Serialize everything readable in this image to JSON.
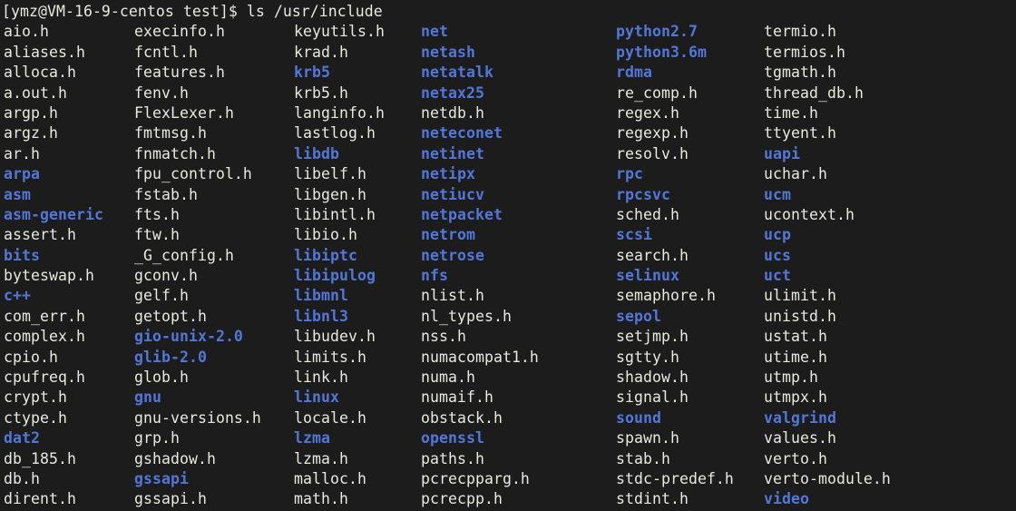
{
  "terminal": {
    "background_color": "#1c1c1c",
    "foreground_color": "#e9e9dd",
    "directory_color": "#5277d9",
    "prompt": "[ymz@VM-16-9-centos test]$ ",
    "command": "ls /usr/include"
  },
  "listing": {
    "columns": [
      {
        "entries": [
          {
            "name": "aio.h",
            "type": "file"
          },
          {
            "name": "aliases.h",
            "type": "file"
          },
          {
            "name": "alloca.h",
            "type": "file"
          },
          {
            "name": "a.out.h",
            "type": "file"
          },
          {
            "name": "argp.h",
            "type": "file"
          },
          {
            "name": "argz.h",
            "type": "file"
          },
          {
            "name": "ar.h",
            "type": "file"
          },
          {
            "name": "arpa",
            "type": "dir"
          },
          {
            "name": "asm",
            "type": "dir"
          },
          {
            "name": "asm-generic",
            "type": "dir"
          },
          {
            "name": "assert.h",
            "type": "file"
          },
          {
            "name": "bits",
            "type": "dir"
          },
          {
            "name": "byteswap.h",
            "type": "file"
          },
          {
            "name": "c++",
            "type": "dir"
          },
          {
            "name": "com_err.h",
            "type": "file"
          },
          {
            "name": "complex.h",
            "type": "file"
          },
          {
            "name": "cpio.h",
            "type": "file"
          },
          {
            "name": "cpufreq.h",
            "type": "file"
          },
          {
            "name": "crypt.h",
            "type": "file"
          },
          {
            "name": "ctype.h",
            "type": "file"
          },
          {
            "name": "dat2",
            "type": "dir"
          },
          {
            "name": "db_185.h",
            "type": "file"
          },
          {
            "name": "db.h",
            "type": "file"
          },
          {
            "name": "dirent.h",
            "type": "file"
          }
        ]
      },
      {
        "entries": [
          {
            "name": "execinfo.h",
            "type": "file"
          },
          {
            "name": "fcntl.h",
            "type": "file"
          },
          {
            "name": "features.h",
            "type": "file"
          },
          {
            "name": "fenv.h",
            "type": "file"
          },
          {
            "name": "FlexLexer.h",
            "type": "file"
          },
          {
            "name": "fmtmsg.h",
            "type": "file"
          },
          {
            "name": "fnmatch.h",
            "type": "file"
          },
          {
            "name": "fpu_control.h",
            "type": "file"
          },
          {
            "name": "fstab.h",
            "type": "file"
          },
          {
            "name": "fts.h",
            "type": "file"
          },
          {
            "name": "ftw.h",
            "type": "file"
          },
          {
            "name": "_G_config.h",
            "type": "file"
          },
          {
            "name": "gconv.h",
            "type": "file"
          },
          {
            "name": "gelf.h",
            "type": "file"
          },
          {
            "name": "getopt.h",
            "type": "file"
          },
          {
            "name": "gio-unix-2.0",
            "type": "dir"
          },
          {
            "name": "glib-2.0",
            "type": "dir"
          },
          {
            "name": "glob.h",
            "type": "file"
          },
          {
            "name": "gnu",
            "type": "dir"
          },
          {
            "name": "gnu-versions.h",
            "type": "file"
          },
          {
            "name": "grp.h",
            "type": "file"
          },
          {
            "name": "gshadow.h",
            "type": "file"
          },
          {
            "name": "gssapi",
            "type": "dir"
          },
          {
            "name": "gssapi.h",
            "type": "file"
          }
        ]
      },
      {
        "entries": [
          {
            "name": "keyutils.h",
            "type": "file"
          },
          {
            "name": "krad.h",
            "type": "file"
          },
          {
            "name": "krb5",
            "type": "dir"
          },
          {
            "name": "krb5.h",
            "type": "file"
          },
          {
            "name": "langinfo.h",
            "type": "file"
          },
          {
            "name": "lastlog.h",
            "type": "file"
          },
          {
            "name": "libdb",
            "type": "dir"
          },
          {
            "name": "libelf.h",
            "type": "file"
          },
          {
            "name": "libgen.h",
            "type": "file"
          },
          {
            "name": "libintl.h",
            "type": "file"
          },
          {
            "name": "libio.h",
            "type": "file"
          },
          {
            "name": "libiptc",
            "type": "dir"
          },
          {
            "name": "libipulog",
            "type": "dir"
          },
          {
            "name": "libmnl",
            "type": "dir"
          },
          {
            "name": "libnl3",
            "type": "dir"
          },
          {
            "name": "libudev.h",
            "type": "file"
          },
          {
            "name": "limits.h",
            "type": "file"
          },
          {
            "name": "link.h",
            "type": "file"
          },
          {
            "name": "linux",
            "type": "dir"
          },
          {
            "name": "locale.h",
            "type": "file"
          },
          {
            "name": "lzma",
            "type": "dir"
          },
          {
            "name": "lzma.h",
            "type": "file"
          },
          {
            "name": "malloc.h",
            "type": "file"
          },
          {
            "name": "math.h",
            "type": "file"
          }
        ]
      },
      {
        "entries": [
          {
            "name": "net",
            "type": "dir"
          },
          {
            "name": "netash",
            "type": "dir"
          },
          {
            "name": "netatalk",
            "type": "dir"
          },
          {
            "name": "netax25",
            "type": "dir"
          },
          {
            "name": "netdb.h",
            "type": "file"
          },
          {
            "name": "neteconet",
            "type": "dir"
          },
          {
            "name": "netinet",
            "type": "dir"
          },
          {
            "name": "netipx",
            "type": "dir"
          },
          {
            "name": "netiucv",
            "type": "dir"
          },
          {
            "name": "netpacket",
            "type": "dir"
          },
          {
            "name": "netrom",
            "type": "dir"
          },
          {
            "name": "netrose",
            "type": "dir"
          },
          {
            "name": "nfs",
            "type": "dir"
          },
          {
            "name": "nlist.h",
            "type": "file"
          },
          {
            "name": "nl_types.h",
            "type": "file"
          },
          {
            "name": "nss.h",
            "type": "file"
          },
          {
            "name": "numacompat1.h",
            "type": "file"
          },
          {
            "name": "numa.h",
            "type": "file"
          },
          {
            "name": "numaif.h",
            "type": "file"
          },
          {
            "name": "obstack.h",
            "type": "file"
          },
          {
            "name": "openssl",
            "type": "dir"
          },
          {
            "name": "paths.h",
            "type": "file"
          },
          {
            "name": "pcrecpparg.h",
            "type": "file"
          },
          {
            "name": "pcrecpp.h",
            "type": "file"
          }
        ]
      },
      {
        "entries": [
          {
            "name": "python2.7",
            "type": "dir"
          },
          {
            "name": "python3.6m",
            "type": "dir"
          },
          {
            "name": "rdma",
            "type": "dir"
          },
          {
            "name": "re_comp.h",
            "type": "file"
          },
          {
            "name": "regex.h",
            "type": "file"
          },
          {
            "name": "regexp.h",
            "type": "file"
          },
          {
            "name": "resolv.h",
            "type": "file"
          },
          {
            "name": "rpc",
            "type": "dir"
          },
          {
            "name": "rpcsvc",
            "type": "dir"
          },
          {
            "name": "sched.h",
            "type": "file"
          },
          {
            "name": "scsi",
            "type": "dir"
          },
          {
            "name": "search.h",
            "type": "file"
          },
          {
            "name": "selinux",
            "type": "dir"
          },
          {
            "name": "semaphore.h",
            "type": "file"
          },
          {
            "name": "sepol",
            "type": "dir"
          },
          {
            "name": "setjmp.h",
            "type": "file"
          },
          {
            "name": "sgtty.h",
            "type": "file"
          },
          {
            "name": "shadow.h",
            "type": "file"
          },
          {
            "name": "signal.h",
            "type": "file"
          },
          {
            "name": "sound",
            "type": "dir"
          },
          {
            "name": "spawn.h",
            "type": "file"
          },
          {
            "name": "stab.h",
            "type": "file"
          },
          {
            "name": "stdc-predef.h",
            "type": "file"
          },
          {
            "name": "stdint.h",
            "type": "file"
          }
        ]
      },
      {
        "entries": [
          {
            "name": "termio.h",
            "type": "file"
          },
          {
            "name": "termios.h",
            "type": "file"
          },
          {
            "name": "tgmath.h",
            "type": "file"
          },
          {
            "name": "thread_db.h",
            "type": "file"
          },
          {
            "name": "time.h",
            "type": "file"
          },
          {
            "name": "ttyent.h",
            "type": "file"
          },
          {
            "name": "uapi",
            "type": "dir"
          },
          {
            "name": "uchar.h",
            "type": "file"
          },
          {
            "name": "ucm",
            "type": "dir"
          },
          {
            "name": "ucontext.h",
            "type": "file"
          },
          {
            "name": "ucp",
            "type": "dir"
          },
          {
            "name": "ucs",
            "type": "dir"
          },
          {
            "name": "uct",
            "type": "dir"
          },
          {
            "name": "ulimit.h",
            "type": "file"
          },
          {
            "name": "unistd.h",
            "type": "file"
          },
          {
            "name": "ustat.h",
            "type": "file"
          },
          {
            "name": "utime.h",
            "type": "file"
          },
          {
            "name": "utmp.h",
            "type": "file"
          },
          {
            "name": "utmpx.h",
            "type": "file"
          },
          {
            "name": "valgrind",
            "type": "dir"
          },
          {
            "name": "values.h",
            "type": "file"
          },
          {
            "name": "verto.h",
            "type": "file"
          },
          {
            "name": "verto-module.h",
            "type": "file"
          },
          {
            "name": "video",
            "type": "dir"
          }
        ]
      }
    ]
  }
}
